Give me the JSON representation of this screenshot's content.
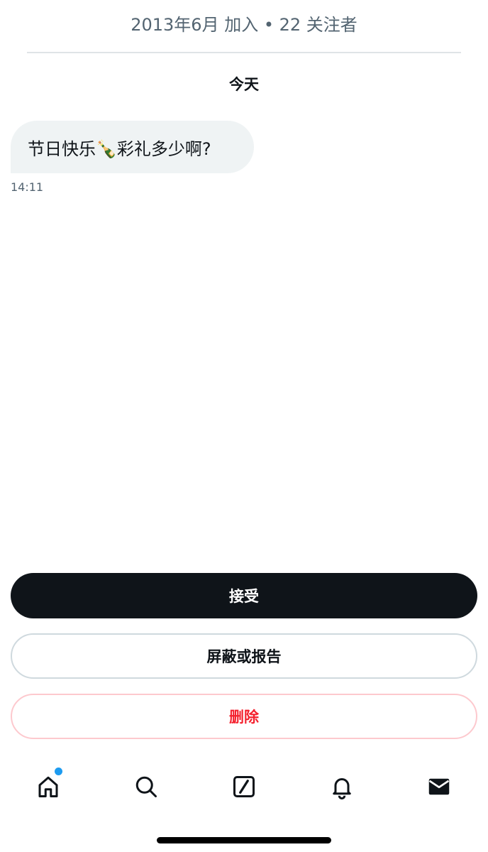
{
  "header": {
    "profile_meta": "2013年6月 加入 • 22 关注者"
  },
  "conversation": {
    "day_label": "今天",
    "messages": [
      {
        "text": "节日快乐🍾彩礼多少啊?",
        "time": "14:11"
      }
    ]
  },
  "actions": {
    "accept_label": "接受",
    "block_label": "屏蔽或报告",
    "delete_label": "删除"
  },
  "tab_bar": {
    "items": [
      {
        "icon": "home-icon",
        "has_notification_dot": true
      },
      {
        "icon": "search-icon"
      },
      {
        "icon": "grok-icon"
      },
      {
        "icon": "bell-icon"
      },
      {
        "icon": "envelope-icon"
      }
    ]
  },
  "colors": {
    "text_primary": "#0f1419",
    "text_secondary": "#536471",
    "bubble_bg": "#eff3f4",
    "delete_red": "#f4212e",
    "accent_blue": "#1d9bf0"
  }
}
